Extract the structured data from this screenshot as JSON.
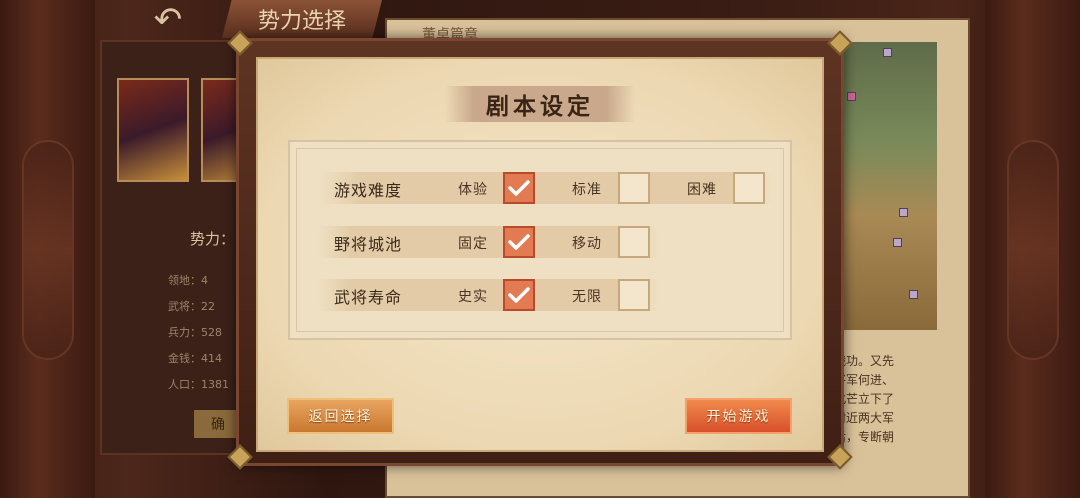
{
  "background": {
    "back_icon": "back-arrow-icon",
    "screen_title": "势力选择",
    "left_panel": {
      "faction_label": "势力：",
      "stats": [
        "领地：4",
        "武将：22",
        "兵力：528",
        "金钱：414",
        "人口：1381"
      ],
      "confirm_label": "确"
    },
    "right_panel": {
      "header": "董卓篇章",
      "story_lines": [
        "建战功。又先",
        "大将军何进、",
        "在北芒立下了",
        "了附近两大军",
        "太后，专断朝"
      ]
    }
  },
  "modal": {
    "title": "剧本设定",
    "rows": [
      {
        "label": "游戏难度",
        "options": [
          {
            "label": "体验",
            "checked": true
          },
          {
            "label": "标准",
            "checked": false
          },
          {
            "label": "困难",
            "checked": false
          }
        ]
      },
      {
        "label": "野将城池",
        "options": [
          {
            "label": "固定",
            "checked": true
          },
          {
            "label": "移动",
            "checked": false
          }
        ]
      },
      {
        "label": "武将寿命",
        "options": [
          {
            "label": "史实",
            "checked": true
          },
          {
            "label": "无限",
            "checked": false
          }
        ]
      }
    ],
    "back_button": "返回选择",
    "start_button": "开始游戏"
  },
  "colors": {
    "checked_fill": "#e27a52",
    "start_button": "#d8502a",
    "back_button": "#c9782f",
    "paper": "#f4e6c8"
  }
}
